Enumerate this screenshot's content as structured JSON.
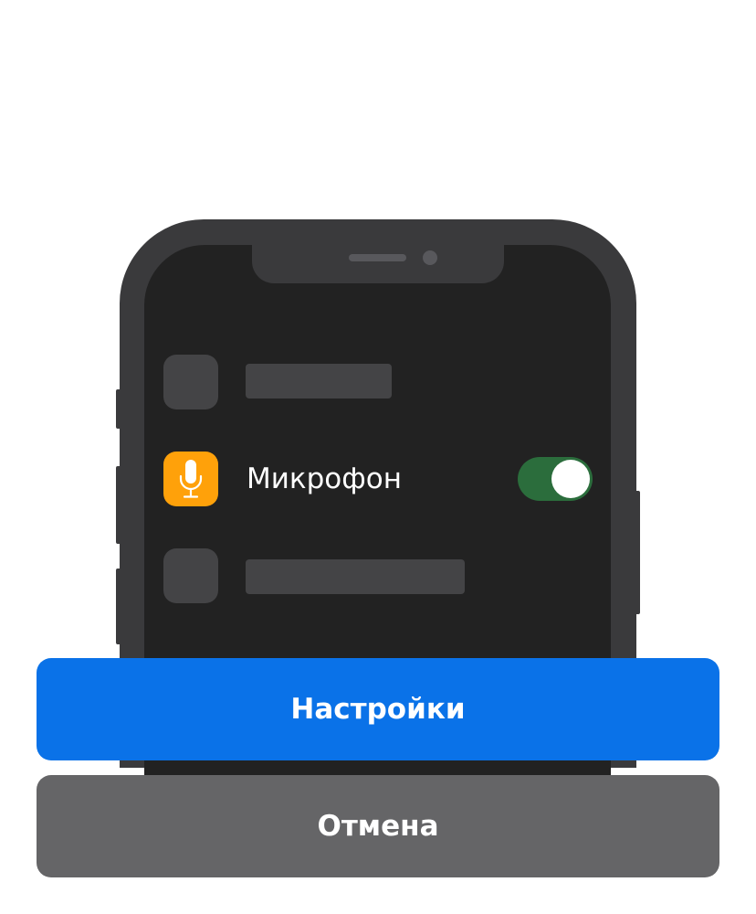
{
  "permission_row": {
    "label": "Микрофон",
    "toggle_on": true,
    "icon": "microphone-icon",
    "icon_color": "#ffa10a"
  },
  "buttons": {
    "settings_label": "Настройки",
    "cancel_label": "Отмена"
  },
  "colors": {
    "primary_button": "#0a72e8",
    "secondary_button": "#656567",
    "toggle_on": "#2b6d3c",
    "phone_body": "#3a3a3c",
    "phone_screen": "#222222"
  }
}
